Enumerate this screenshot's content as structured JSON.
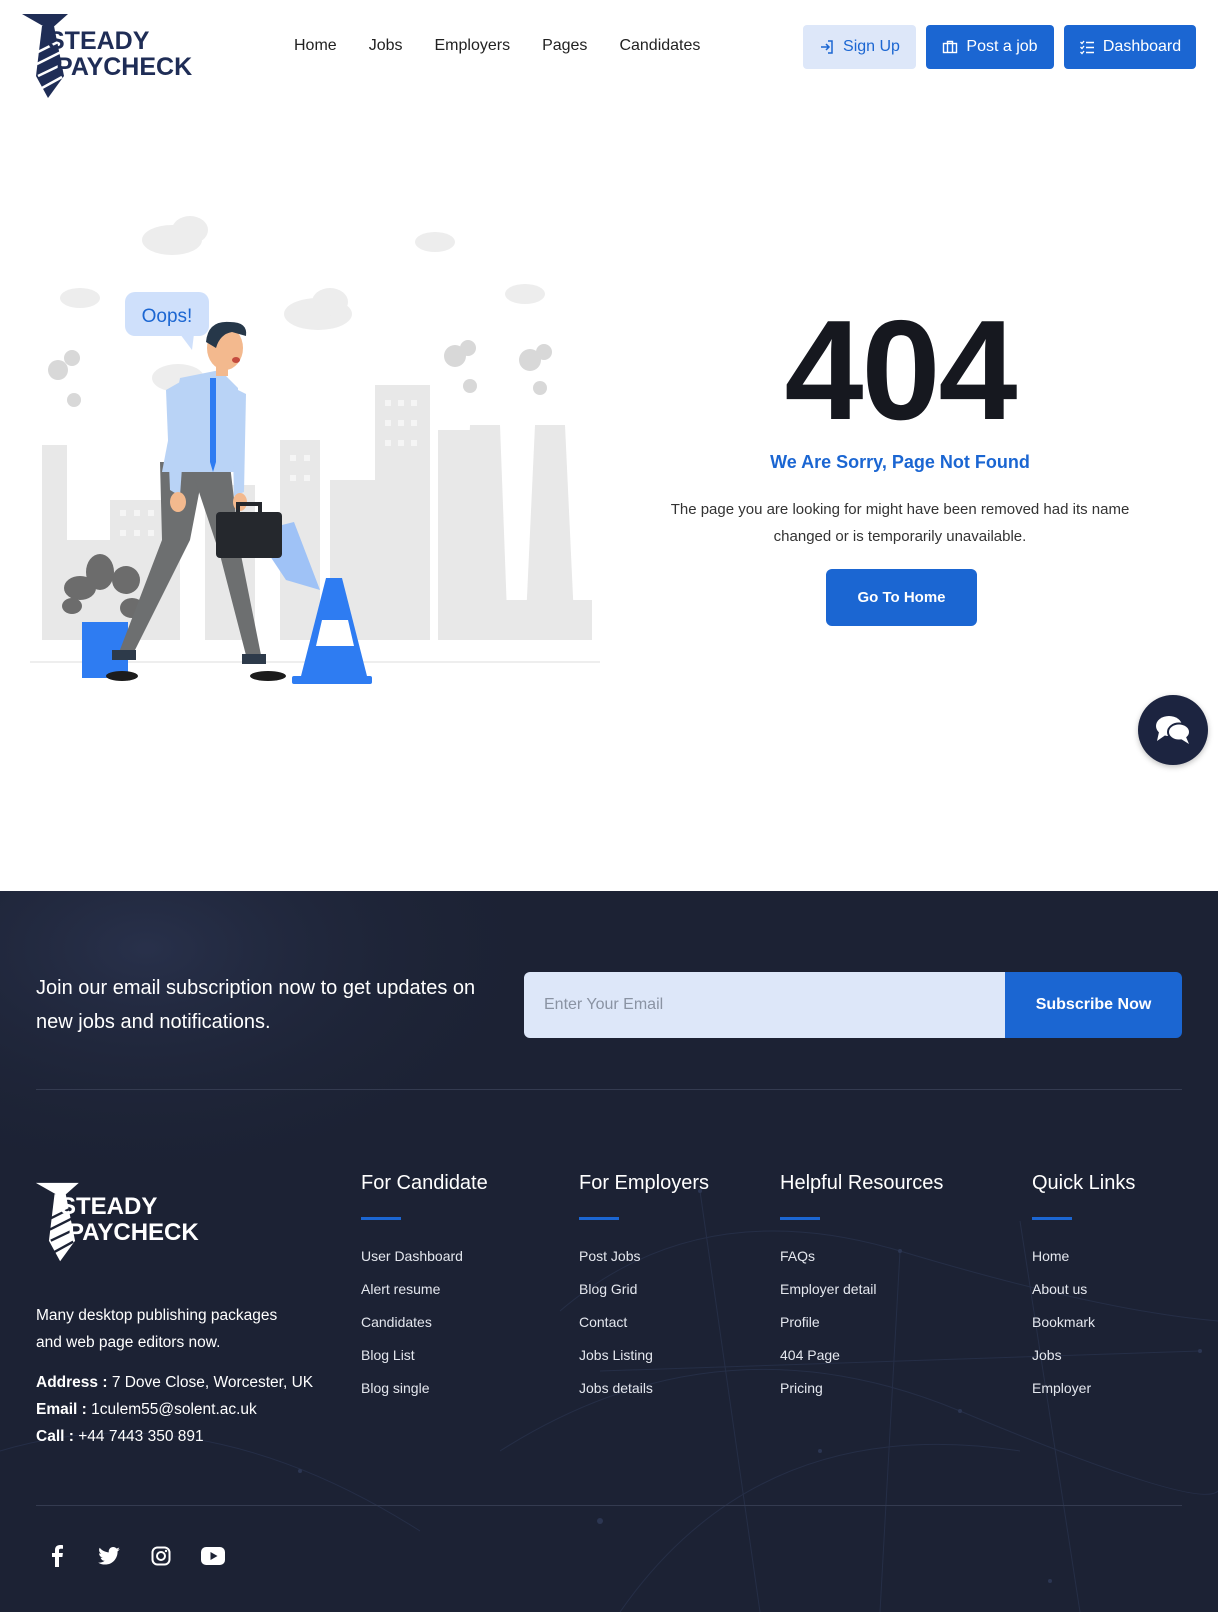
{
  "brand": {
    "name_line1": "STEADY",
    "name_line2": "PAYCHECK"
  },
  "nav": {
    "items": [
      "Home",
      "Jobs",
      "Employers",
      "Pages",
      "Candidates"
    ]
  },
  "header_buttons": {
    "signup": "Sign Up",
    "post_job": "Post a job",
    "dashboard": "Dashboard"
  },
  "illustration": {
    "speech_bubble": "Oops!"
  },
  "error": {
    "code": "404",
    "title": "We Are Sorry, Page Not Found",
    "message": "The page you are looking for might have been removed had its name changed or is temporarily unavailable.",
    "button": "Go To Home"
  },
  "subscribe": {
    "text": "Join our email subscription now to get updates on new jobs and notifications.",
    "placeholder": "Enter Your Email",
    "button": "Subscribe Now"
  },
  "footer": {
    "description": "Many desktop publishing packages and web page editors now.",
    "address_label": "Address :",
    "address": "7 Dove Close, Worcester, UK",
    "email_label": "Email :",
    "email": "1culem55@solent.ac.uk",
    "call_label": "Call :",
    "call": "+44 7443 350 891",
    "columns": [
      {
        "title": "For Candidate",
        "links": [
          "User Dashboard",
          "Alert resume",
          "Candidates",
          "Blog List",
          "Blog single"
        ]
      },
      {
        "title": "For Employers",
        "links": [
          "Post Jobs",
          "Blog Grid",
          "Contact",
          "Jobs Listing",
          "Jobs details"
        ]
      },
      {
        "title": "Helpful Resources",
        "links": [
          "FAQs",
          "Employer detail",
          "Profile",
          "404 Page",
          "Pricing"
        ]
      },
      {
        "title": "Quick Links",
        "links": [
          "Home",
          "About us",
          "Bookmark",
          "Jobs",
          "Employer"
        ]
      }
    ],
    "socials": [
      "facebook-icon",
      "twitter-icon",
      "instagram-icon",
      "youtube-icon"
    ]
  },
  "colors": {
    "primary": "#1b66d2",
    "light_primary": "#dde7f9",
    "footer_bg": "#1c2234",
    "heading": "#16181f"
  }
}
